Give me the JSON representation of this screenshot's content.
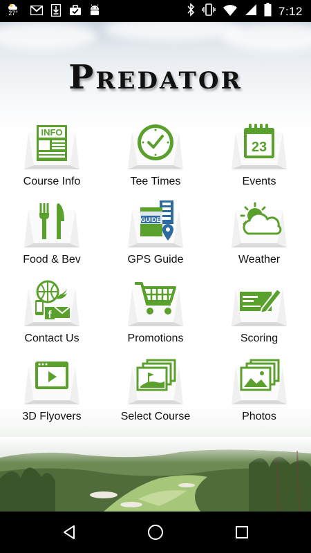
{
  "status_bar": {
    "temperature": "27°",
    "time": "7:12",
    "left_icons": [
      "weather-icon",
      "gmail-icon",
      "download-icon",
      "briefcase-check-icon",
      "android-icon"
    ],
    "right_icons": [
      "bluetooth-icon",
      "vibrate-icon",
      "wifi-icon",
      "signal-icon",
      "battery-icon"
    ]
  },
  "app": {
    "logo": "Predator",
    "accent_color": "#5aa02c",
    "menu": [
      {
        "label": "Course Info",
        "icon": "info-document-icon"
      },
      {
        "label": "Tee Times",
        "icon": "clock-check-icon"
      },
      {
        "label": "Events",
        "icon": "calendar-23-icon",
        "badge": "23"
      },
      {
        "label": "Food & Bev",
        "icon": "fork-knife-icon"
      },
      {
        "label": "GPS Guide",
        "icon": "gps-guide-icon",
        "badge": "GUIDE"
      },
      {
        "label": "Weather",
        "icon": "sun-cloud-icon"
      },
      {
        "label": "Contact Us",
        "icon": "contact-social-icon"
      },
      {
        "label": "Promotions",
        "icon": "shopping-cart-icon"
      },
      {
        "label": "Scoring",
        "icon": "scorecard-pencil-icon"
      },
      {
        "label": "3D Flyovers",
        "icon": "video-play-icon"
      },
      {
        "label": "Select Course",
        "icon": "course-photos-icon"
      },
      {
        "label": "Photos",
        "icon": "photos-stack-icon"
      }
    ]
  },
  "nav_bar": {
    "buttons": [
      "back",
      "home",
      "recents"
    ]
  }
}
